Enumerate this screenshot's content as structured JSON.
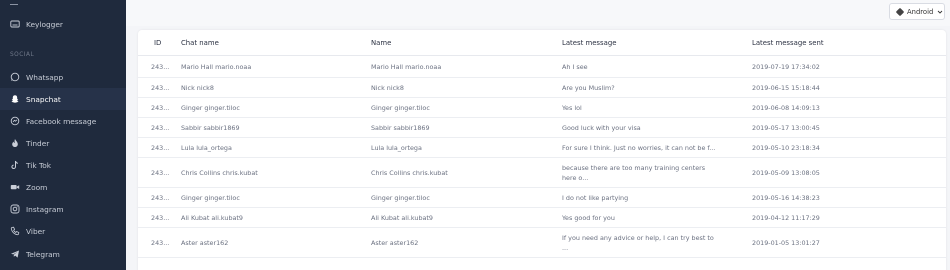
{
  "sidebar": {
    "section_label": "SOCIAL",
    "items": [
      {
        "label": "Keylogger",
        "icon": "keyboard-icon"
      },
      {
        "label": "Whatsapp",
        "icon": "whatsapp-icon"
      },
      {
        "label": "Snapchat",
        "icon": "snapchat-icon",
        "active": true
      },
      {
        "label": "Facebook message",
        "icon": "messenger-icon"
      },
      {
        "label": "Tinder",
        "icon": "flame-icon"
      },
      {
        "label": "Tik Tok",
        "icon": "tiktok-icon"
      },
      {
        "label": "Zoom",
        "icon": "video-camera-icon"
      },
      {
        "label": "Instagram",
        "icon": "instagram-icon"
      },
      {
        "label": "Viber",
        "icon": "phone-icon"
      },
      {
        "label": "Telegram",
        "icon": "send-icon"
      }
    ]
  },
  "topbar": {
    "platform": "Android"
  },
  "table": {
    "headers": {
      "id": "ID",
      "chat_name": "Chat name",
      "name": "Name",
      "latest_message": "Latest message",
      "latest_sent": "Latest message sent"
    },
    "rows": [
      {
        "id": "243...",
        "chat_name": "Mario Hall mario.noaa",
        "name": "Mario Hall mario.noaa",
        "message": "Ah I see",
        "sent": "2019-07-19 17:34:02"
      },
      {
        "id": "243...",
        "chat_name": "Nick nick8",
        "name": "Nick nick8",
        "message": "Are you Muslim?",
        "sent": "2019-06-15 15:18:44"
      },
      {
        "id": "243...",
        "chat_name": "Ginger ginger.tiloc",
        "name": "Ginger ginger.tiloc",
        "message": "Yes lol",
        "sent": "2019-06-08 14:09:13"
      },
      {
        "id": "243...",
        "chat_name": "Sabbir sabbir1869",
        "name": "Sabbir sabbir1869",
        "message": "Good luck with your visa",
        "sent": "2019-05-17 13:00:45"
      },
      {
        "id": "243...",
        "chat_name": "Lula lula_ortega",
        "name": "Lula lula_ortega",
        "message": "For sure I think. Just no worries, it can not be f...",
        "sent": "2019-05-10 23:18:34"
      },
      {
        "id": "243...",
        "chat_name": "Chris Collins chris.kubat",
        "name": "Chris Collins chris.kubat",
        "message": "because there are too many training centers here o...",
        "sent": "2019-05-09 13:08:05"
      },
      {
        "id": "243...",
        "chat_name": "Ginger ginger.tiloc",
        "name": "Ginger ginger.tiloc",
        "message": "I do not like partying",
        "sent": "2019-05-16 14:38:23"
      },
      {
        "id": "243...",
        "chat_name": "Ali Kubat ali.kubat9",
        "name": "Ali Kubat ali.kubat9",
        "message": "Yes good for you",
        "sent": "2019-04-12 11:17:29"
      },
      {
        "id": "243...",
        "chat_name": "Aster aster162",
        "name": "Aster aster162",
        "message": "If you need any advice or help, I can try best to ...",
        "sent": "2019-01-05 13:01:27"
      }
    ]
  }
}
